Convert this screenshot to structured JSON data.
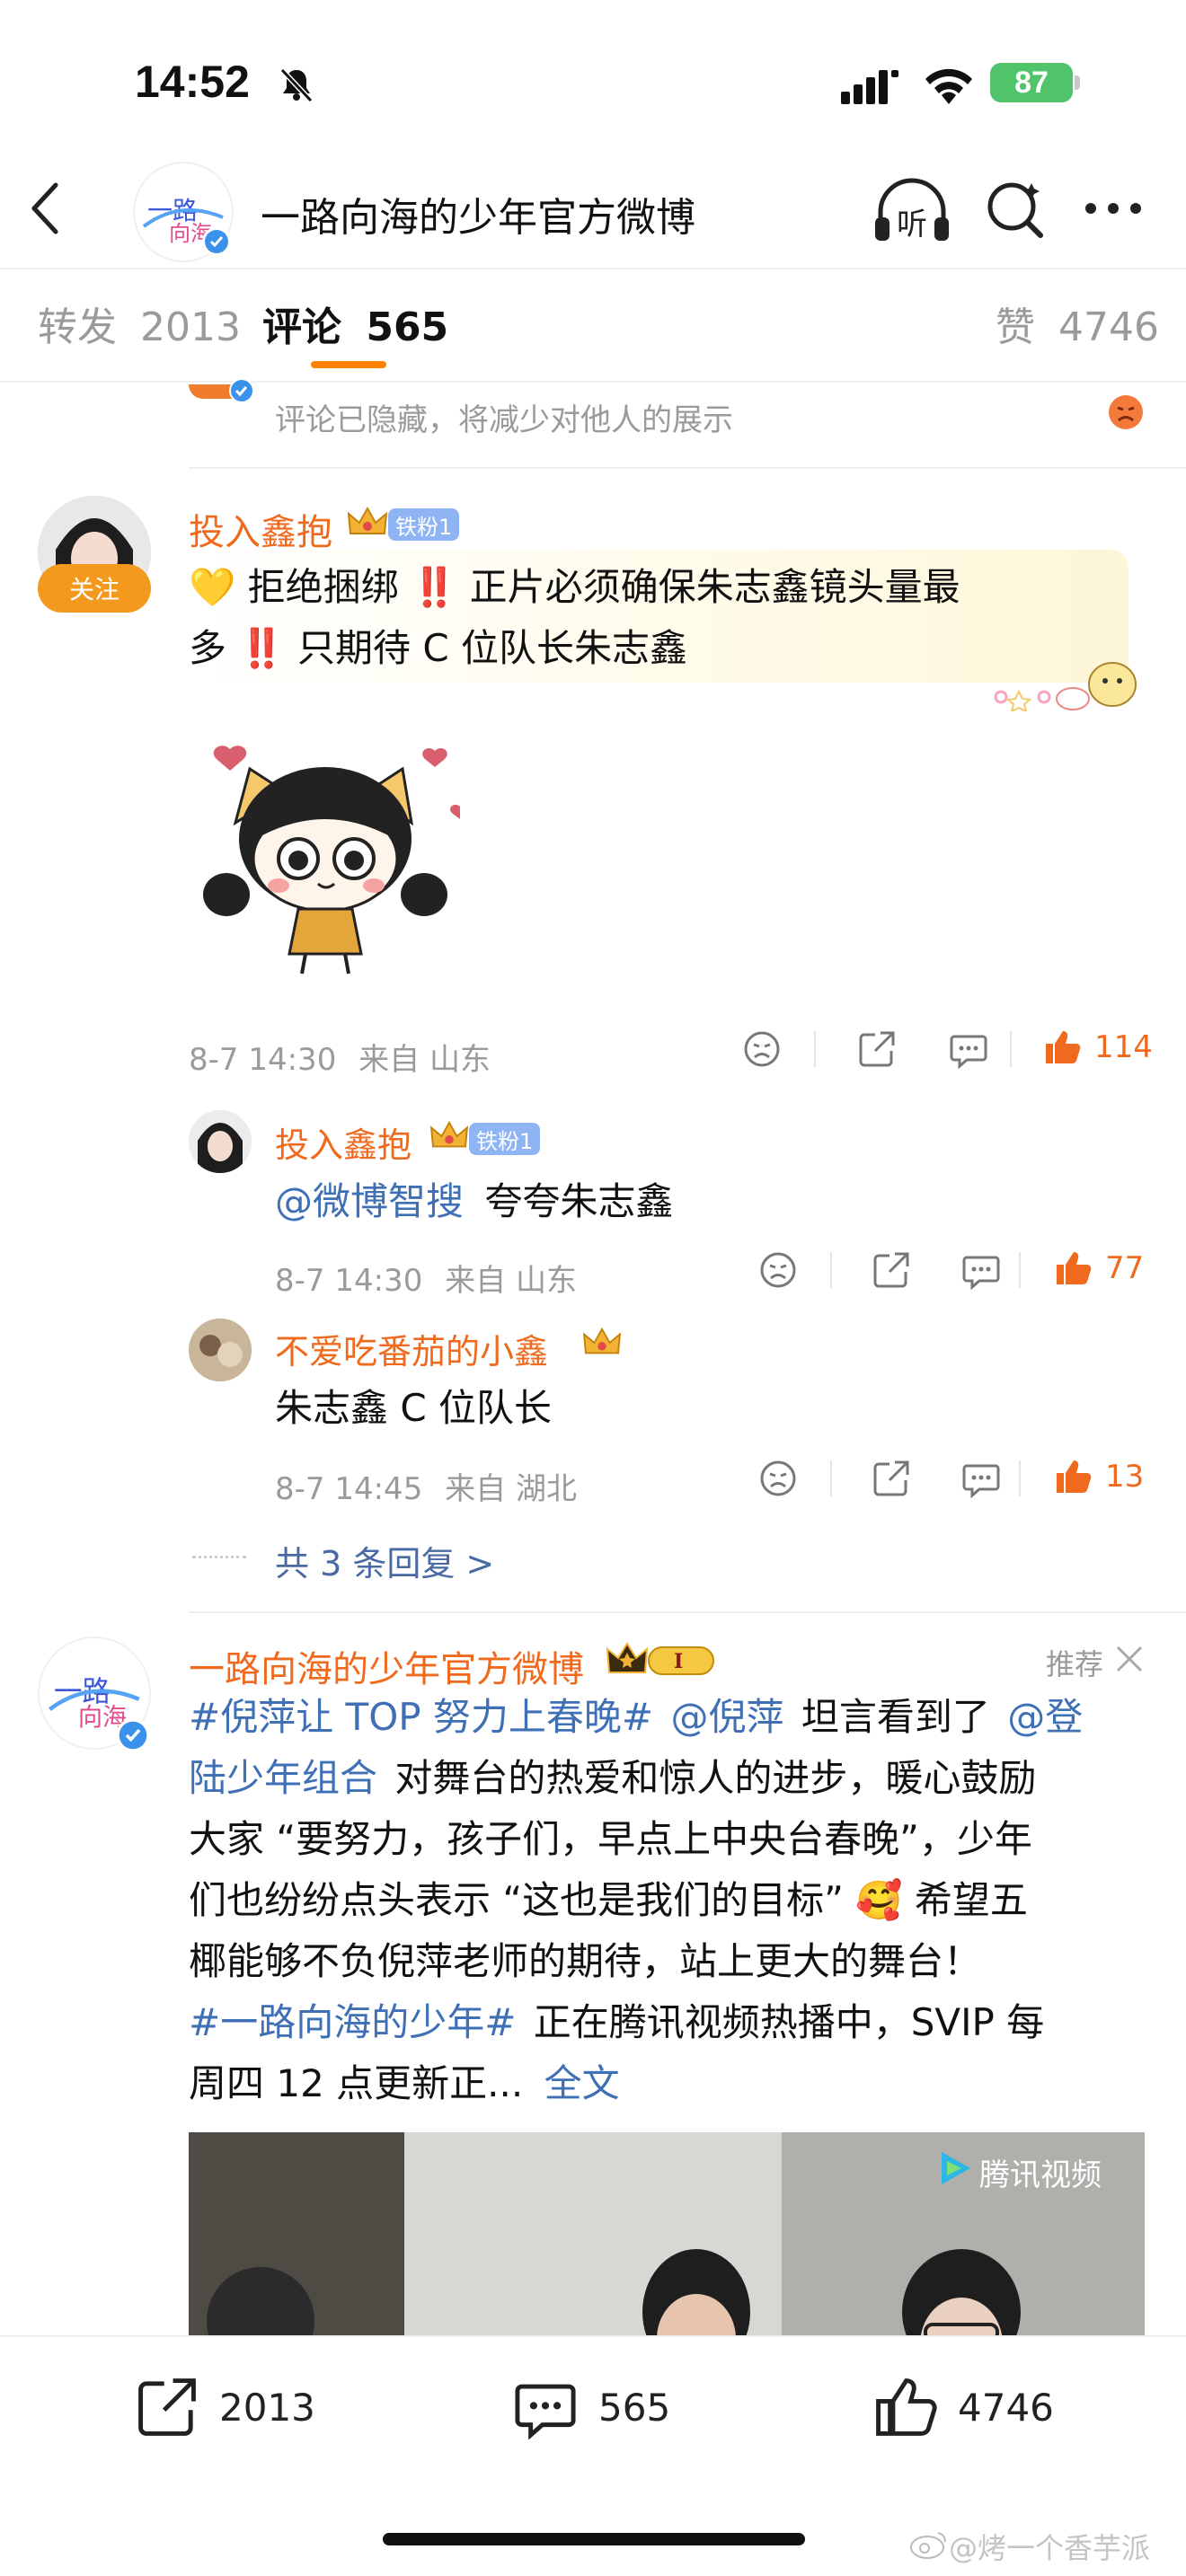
{
  "status_bar": {
    "time": "14:52",
    "battery": "87"
  },
  "header": {
    "title": "一路向海的少年官方微博",
    "listen_label": "听"
  },
  "tabs": {
    "repost": {
      "label": "转发",
      "count": "2013"
    },
    "comment": {
      "label": "评论",
      "count": "565"
    },
    "like": {
      "label": "赞",
      "count": "4746"
    }
  },
  "hidden_notice": {
    "text": "评论已隐藏，将减少对他人的展示"
  },
  "comment1": {
    "follow_label": "关注",
    "username": "投入鑫抱",
    "badge": "铁粉1",
    "text_line1": "💛 拒绝捆绑 ‼️ 正片必须确保朱志鑫镜头量最",
    "text_line2": "多 ‼️ 只期待 C 位队长朱志鑫",
    "time": "8-7 14:30",
    "location": "来自 山东",
    "likes": "114"
  },
  "reply1": {
    "username": "投入鑫抱",
    "badge": "铁粉1",
    "mention": "@微博智搜",
    "text": "夸夸朱志鑫",
    "time": "8-7 14:30",
    "location": "来自 山东",
    "likes": "77"
  },
  "reply2": {
    "username": "不爱吃番茄的小鑫",
    "text": "朱志鑫 C 位队长",
    "time": "8-7 14:45",
    "location": "来自 湖北",
    "likes": "13"
  },
  "more_replies": {
    "text": "共 3 条回复 >"
  },
  "promo": {
    "username": "一路向海的少年官方微博",
    "tag_label": "推荐",
    "line1_hashtag": "#倪萍让 TOP 努力上春晚#",
    "line1_mention": "@倪萍",
    "line1_text": "坦言看到了",
    "line1_mention2": "@登",
    "line2_mention": "陆少年组合",
    "line2_text": "对舞台的热爱和惊人的进步，暖心鼓励",
    "line3": "大家 “要努力，孩子们，早点上中央台春晚”，少年",
    "line4": "们也纷纷点头表示 “这也是我们的目标” 🥰 希望五",
    "line5": "椰能够不负倪萍老师的期待，站上更大的舞台！",
    "line6_hashtag": "#一路向海的少年#",
    "line6_text": "正在腾讯视频热播中，SVIP 每",
    "line7_text": "周四 12 点更新正...",
    "line7_link": "全文",
    "video_watermark": "腾讯视频"
  },
  "bottom_bar": {
    "reposts": "2013",
    "comments": "565",
    "likes": "4746"
  },
  "watermark": "@烤一个香芋派",
  "colors": {
    "accent": "#ff8200",
    "username": "#f06a1d",
    "link": "#3f6fb5",
    "like": "#f06a1d"
  }
}
